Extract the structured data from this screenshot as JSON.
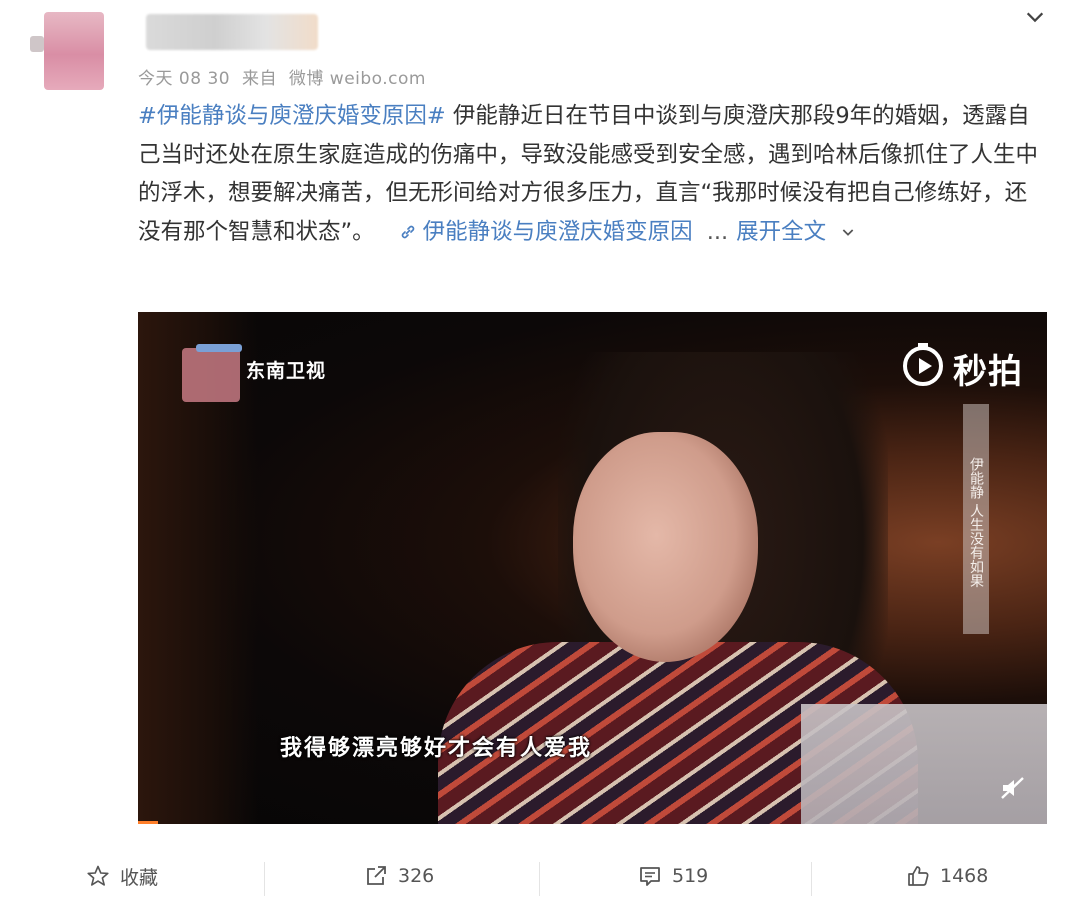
{
  "post": {
    "meta": {
      "time_label": "今天 08 30",
      "source_prefix": "来自",
      "source_name": "微博 weibo.com"
    },
    "text": {
      "hashtag": "#伊能静谈与庾澄庆婚变原因#",
      "body": " 伊能静近日在节目中谈到与庾澄庆那段9年的婚姻，透露自己当时还处在原生家庭造成的伤痛中，导致没能感受到安全感，遇到哈林后像抓住了人生中的浮木，想要解决痛苦，但无形间给对方很多压力，直言“我那时候没有把自己修练好，还没有那个智慧和状态”。",
      "link_text": "伊能静谈与庾澄庆婚变原因",
      "ellipsis": "...",
      "expand_label": "展开全文"
    },
    "video": {
      "channel_name": "东南卫视",
      "platform_name": "秒拍",
      "sidebar_text": "伊能静 人生没有如果",
      "subtitle": "我得够漂亮够好才会有人爱我"
    },
    "actions": {
      "favorite_label": "收藏",
      "repost_count": "326",
      "comment_count": "519",
      "like_count": "1468"
    }
  },
  "icons": {
    "top_chevron": "chevron-down-icon",
    "link": "link-icon",
    "expand_chevron": "chevron-down-icon",
    "platform": "miaopai-play-icon",
    "mute": "mute-icon",
    "favorite": "star-icon",
    "repost": "share-icon",
    "comment": "comment-icon",
    "like": "thumbs-up-icon"
  },
  "colors": {
    "link_blue": "#4a7fc1",
    "meta_gray": "#9a9a9a",
    "text": "#333333"
  }
}
